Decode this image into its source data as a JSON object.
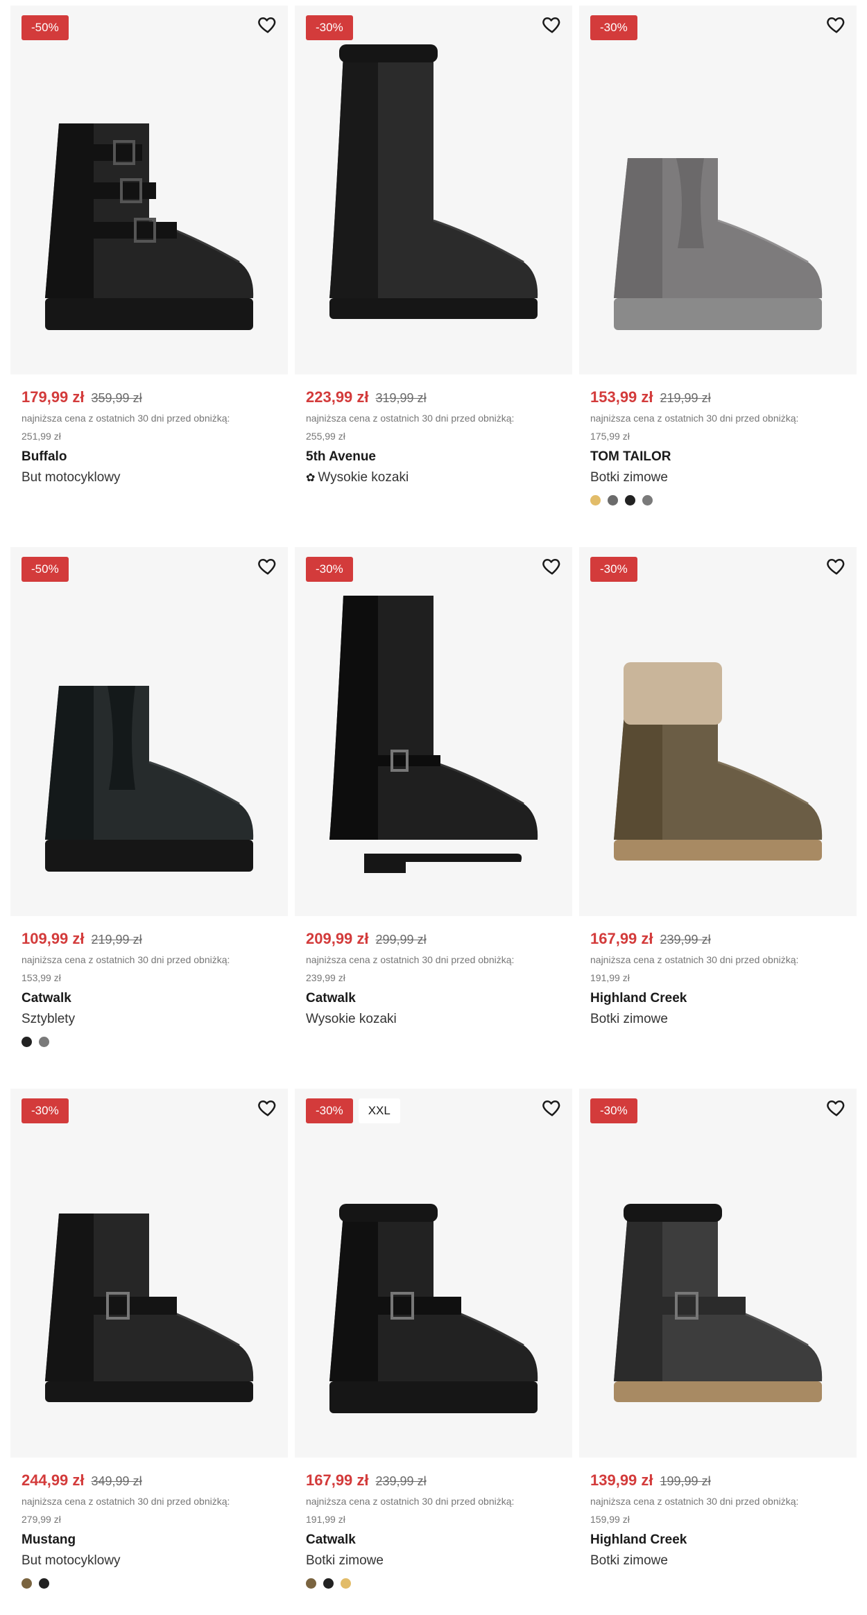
{
  "lowest_price_label": "najniższa cena z ostatnich 30 dni przed obniżką:",
  "products": [
    {
      "discount": "-50%",
      "price": "179,99 zł",
      "old_price": "359,99 zł",
      "lowest_price": "251,99 zł",
      "brand": "Buffalo",
      "type": "But motocyklowy",
      "sustainable": false,
      "extra_badge": "",
      "colors": [],
      "boot": "moto-buckles",
      "boot_color": "#242424"
    },
    {
      "discount": "-30%",
      "price": "223,99 zł",
      "old_price": "319,99 zł",
      "lowest_price": "255,99 zł",
      "brand": "5th Avenue",
      "type": "Wysokie kozaki",
      "sustainable": true,
      "sustainable_icon": "✿",
      "extra_badge": "",
      "colors": [],
      "boot": "tall-fur",
      "boot_color": "#2b2b2b"
    },
    {
      "discount": "-30%",
      "price": "153,99 zł",
      "old_price": "219,99 zł",
      "lowest_price": "175,99 zł",
      "brand": "TOM TAILOR",
      "type": "Botki zimowe",
      "sustainable": false,
      "extra_badge": "",
      "colors": [
        "#e2bc69",
        "#6b6b6b",
        "#222222",
        "#7a7a7a"
      ],
      "boot": "platform-ankle",
      "boot_color": "#7d7b7c"
    },
    {
      "discount": "-50%",
      "price": "109,99 zł",
      "old_price": "219,99 zł",
      "lowest_price": "153,99 zł",
      "brand": "Catwalk",
      "type": "Sztyblety",
      "sustainable": false,
      "extra_badge": "",
      "colors": [
        "#222222",
        "#7a7a7a"
      ],
      "boot": "chelsea",
      "boot_color": "#262b2c"
    },
    {
      "discount": "-30%",
      "price": "209,99 zł",
      "old_price": "299,99 zł",
      "lowest_price": "239,99 zł",
      "brand": "Catwalk",
      "type": "Wysokie kozaki",
      "sustainable": false,
      "extra_badge": "",
      "colors": [],
      "boot": "tall-heel",
      "boot_color": "#1f1f1f"
    },
    {
      "discount": "-30%",
      "price": "167,99 zł",
      "old_price": "239,99 zł",
      "lowest_price": "191,99 zł",
      "brand": "Highland Creek",
      "type": "Botki zimowe",
      "sustainable": false,
      "extra_badge": "",
      "colors": [],
      "boot": "fur-cuff",
      "boot_color": "#6b5d45"
    },
    {
      "discount": "-30%",
      "price": "244,99 zł",
      "old_price": "349,99 zł",
      "lowest_price": "279,99 zł",
      "brand": "Mustang",
      "type": "But motocyklowy",
      "sustainable": false,
      "extra_badge": "",
      "colors": [
        "#7a6440",
        "#222222"
      ],
      "boot": "moto-strap",
      "boot_color": "#262626"
    },
    {
      "discount": "-30%",
      "price": "167,99 zł",
      "old_price": "239,99 zł",
      "lowest_price": "191,99 zł",
      "brand": "Catwalk",
      "type": "Botki zimowe",
      "sustainable": false,
      "extra_badge": "XXL",
      "colors": [
        "#7a6440",
        "#222222",
        "#e2bc69"
      ],
      "boot": "fur-buckle",
      "boot_color": "#222222"
    },
    {
      "discount": "-30%",
      "price": "139,99 zł",
      "old_price": "199,99 zł",
      "lowest_price": "159,99 zł",
      "brand": "Highland Creek",
      "type": "Botki zimowe",
      "sustainable": false,
      "extra_badge": "",
      "colors": [],
      "boot": "fur-strap",
      "boot_color": "#3d3d3d"
    }
  ],
  "icons": {
    "wishlist": "heart-outline-icon"
  }
}
